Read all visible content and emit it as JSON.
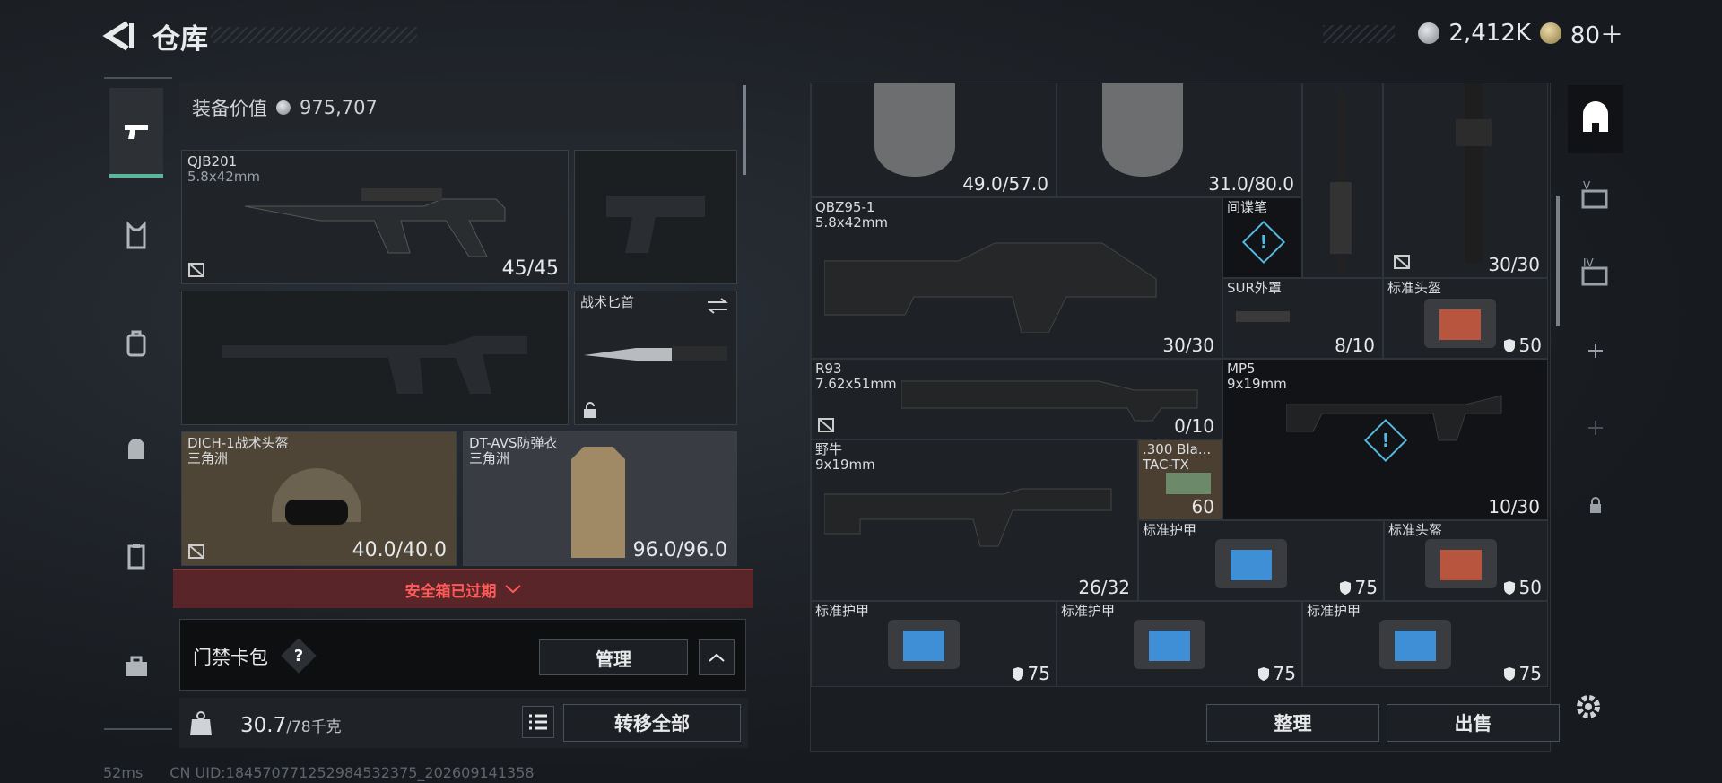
{
  "header": {
    "title": "仓库",
    "silver": "2,412K",
    "gold": "80＋"
  },
  "loadout": {
    "value_label": "装备价值",
    "value": "975,707",
    "primary": {
      "name": "QJB201",
      "caliber": "5.8x42mm",
      "ammo": "45/45"
    },
    "knife": {
      "name": "战术匕首"
    },
    "helmet": {
      "name": "DICH-1战术头盔",
      "brand": "三角洲",
      "durability": "40.0/40.0"
    },
    "armor": {
      "name": "DT-AVS防弹衣",
      "brand": "三角洲",
      "durability": "96.0/96.0"
    },
    "safe_box": "安全箱已过期",
    "keycard": {
      "label": "门禁卡包",
      "help": "?",
      "manage": "管理"
    },
    "weight": {
      "current": "30.7",
      "max": "/78千克"
    },
    "transfer_all": "转移全部"
  },
  "stash": {
    "items": [
      {
        "label": "",
        "count": "49.0/57.0"
      },
      {
        "label": "",
        "count": "31.0/80.0"
      },
      {
        "label": "",
        "count": ""
      },
      {
        "label": "",
        "count": "30/30"
      },
      {
        "label": "QBZ95-1",
        "sub": "5.8x42mm",
        "count": "30/30"
      },
      {
        "label": "间谍笔",
        "count": ""
      },
      {
        "label": "SUR外罩",
        "count": "8/10"
      },
      {
        "label": "标准头盔",
        "count": "50"
      },
      {
        "label": "R93",
        "sub": "7.62x51mm",
        "count": "0/10"
      },
      {
        "label": "MP5",
        "sub": "9x19mm",
        "count": "10/30"
      },
      {
        "label": "野牛",
        "sub": "9x19mm",
        "count": "26/32"
      },
      {
        "label": ".300 Bla...",
        "sub": "TAC-TX",
        "count": "60"
      },
      {
        "label": "标准护甲",
        "count": "75"
      },
      {
        "label": "标准头盔",
        "count": "50"
      },
      {
        "label": "标准护甲",
        "count": "75"
      },
      {
        "label": "标准护甲",
        "count": "75"
      },
      {
        "label": "标准护甲",
        "count": "75"
      }
    ],
    "sort": "整理",
    "sell": "出售"
  },
  "side_tabs": [
    "IV",
    "V"
  ],
  "status": {
    "ping": "52ms",
    "uid": "CN UID:184570771252984532375_202609141358"
  },
  "colors": {
    "accent": "#57b89a",
    "alert": "#56b9e0",
    "danger": "#ff5a5a"
  }
}
